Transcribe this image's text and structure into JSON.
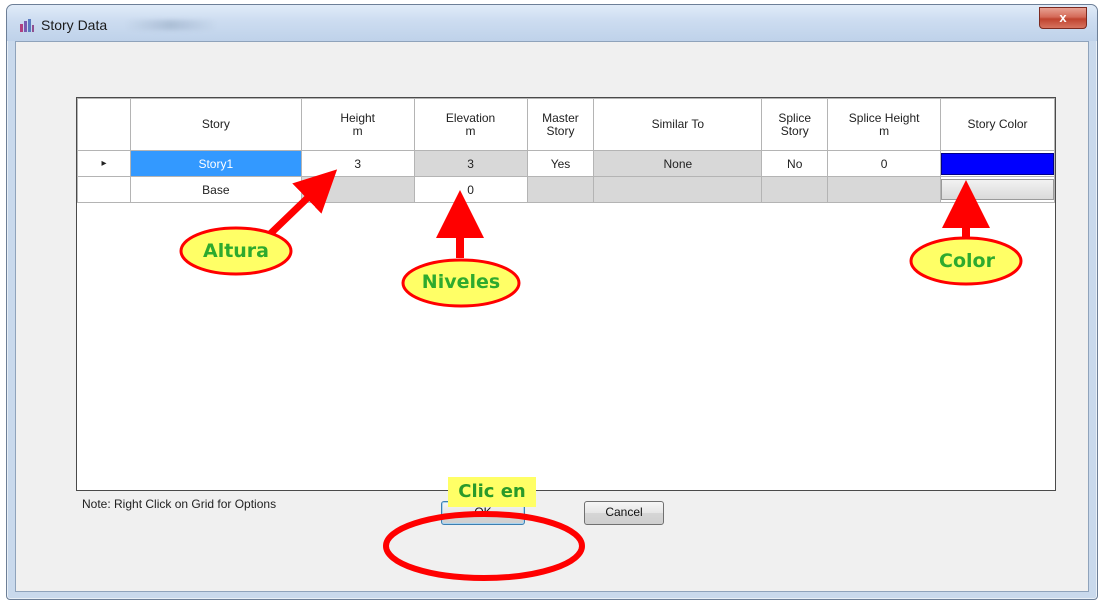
{
  "window": {
    "title": "Story Data",
    "close_label": "x"
  },
  "grid": {
    "columns": [
      "Story",
      "Height\nm",
      "Elevation\nm",
      "Master\nStory",
      "Similar To",
      "Splice\nStory",
      "Splice Height\nm",
      "Story Color"
    ],
    "rows": [
      {
        "current_marker": "▸",
        "story": "Story1",
        "height": "3",
        "elevation": "3",
        "master_story": "Yes",
        "similar_to": "None",
        "splice_story": "No",
        "splice_height": "0",
        "story_color": "#0000ff"
      },
      {
        "current_marker": "",
        "story": "Base",
        "height": "",
        "elevation": "0",
        "master_story": "",
        "similar_to": "",
        "splice_story": "",
        "splice_height": "",
        "story_color": ""
      }
    ]
  },
  "note": "Note:  Right Click on Grid for Options",
  "buttons": {
    "ok": "OK",
    "cancel": "Cancel"
  },
  "annotations": {
    "altura": "Altura",
    "niveles": "Niveles",
    "color": "Color",
    "clic_en": "Clic en",
    "arrow_color": "#ff0000",
    "ellipse_fill": "#ffff66"
  }
}
